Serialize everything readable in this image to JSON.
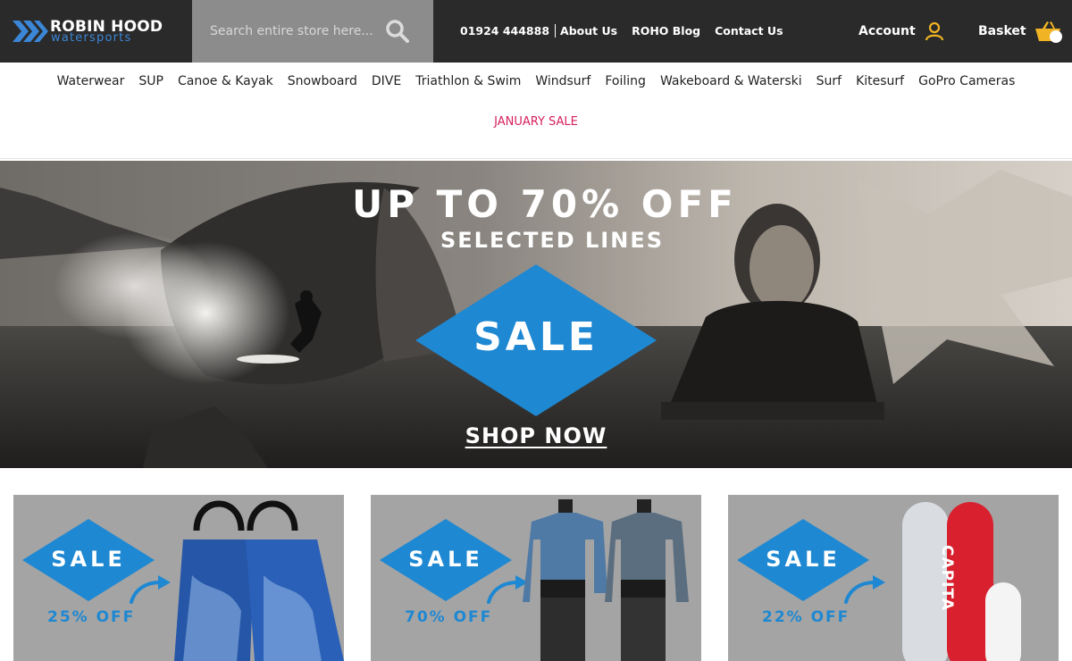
{
  "header": {
    "logo_title": "ROBIN HOOD",
    "logo_subtitle": "watersports",
    "search_placeholder": "Search entire store here...",
    "phone": "01924 444888",
    "links": [
      "About Us",
      "ROHO Blog",
      "Contact Us"
    ],
    "account_label": "Account",
    "basket_label": "Basket"
  },
  "nav": {
    "items": [
      "Waterwear",
      "SUP",
      "Canoe & Kayak",
      "Snowboard",
      "DIVE",
      "Triathlon & Swim",
      "Windsurf",
      "Foiling",
      "Wakeboard & Waterski",
      "Surf",
      "Kitesurf",
      "GoPro Cameras"
    ],
    "sale_link": "JANUARY SALE"
  },
  "hero": {
    "headline": "UP TO 70% OFF",
    "subheadline": "SELECTED LINES",
    "badge": "SALE",
    "cta": "SHOP NOW"
  },
  "tiles": [
    {
      "badge": "SALE",
      "discount": "25% OFF",
      "product_icon": "dive-fins-image"
    },
    {
      "badge": "SALE",
      "discount": "70% OFF",
      "product_icon": "drysuit-image"
    },
    {
      "badge": "SALE",
      "discount": "22% OFF",
      "product_icon": "snowboard-image",
      "brand_mark": "CAPITA"
    }
  ],
  "colors": {
    "header_bg": "#2a2a2a",
    "search_bg": "#8c8c8c",
    "accent_blue": "#1e88d2",
    "sale_pink": "#d61f5b",
    "icon_yellow": "#f0b323"
  }
}
